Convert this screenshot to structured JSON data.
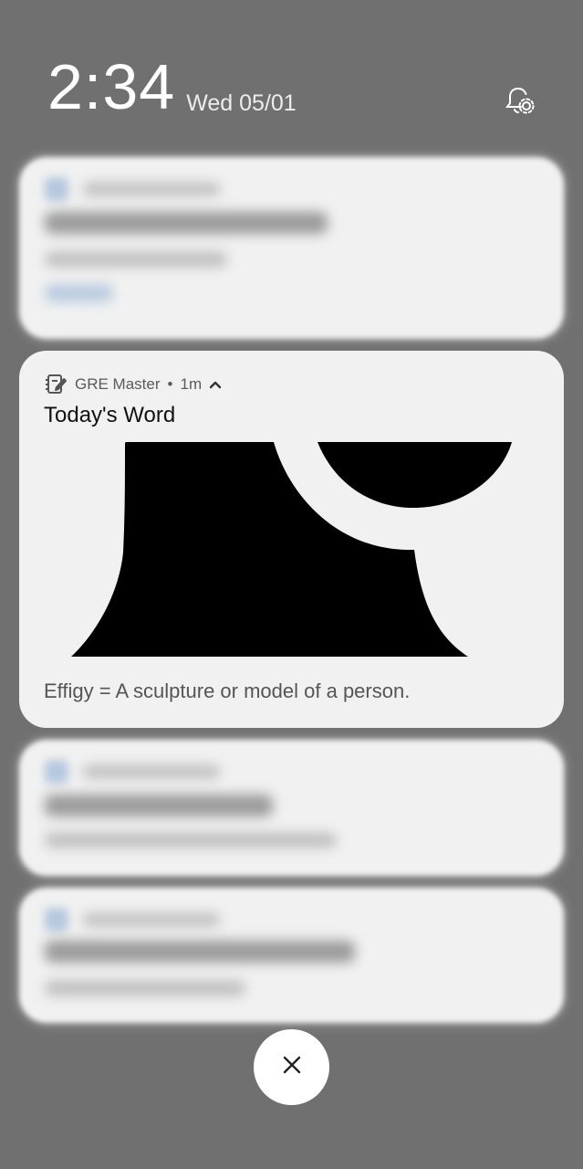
{
  "status": {
    "time": "2:34",
    "date": "Wed 05/01"
  },
  "icons": {
    "settings": "notification-settings-icon",
    "app": "notebook-icon",
    "expand": "chevron-up-icon",
    "dismiss": "close-icon"
  },
  "notification": {
    "app_name": "GRE Master",
    "separator": "•",
    "age": "1m",
    "title": "Today's Word",
    "body": "Effigy = A sculpture or model of a person."
  },
  "colors": {
    "background": "#707070",
    "card": "#f1f1f1",
    "picture": "#000000"
  }
}
